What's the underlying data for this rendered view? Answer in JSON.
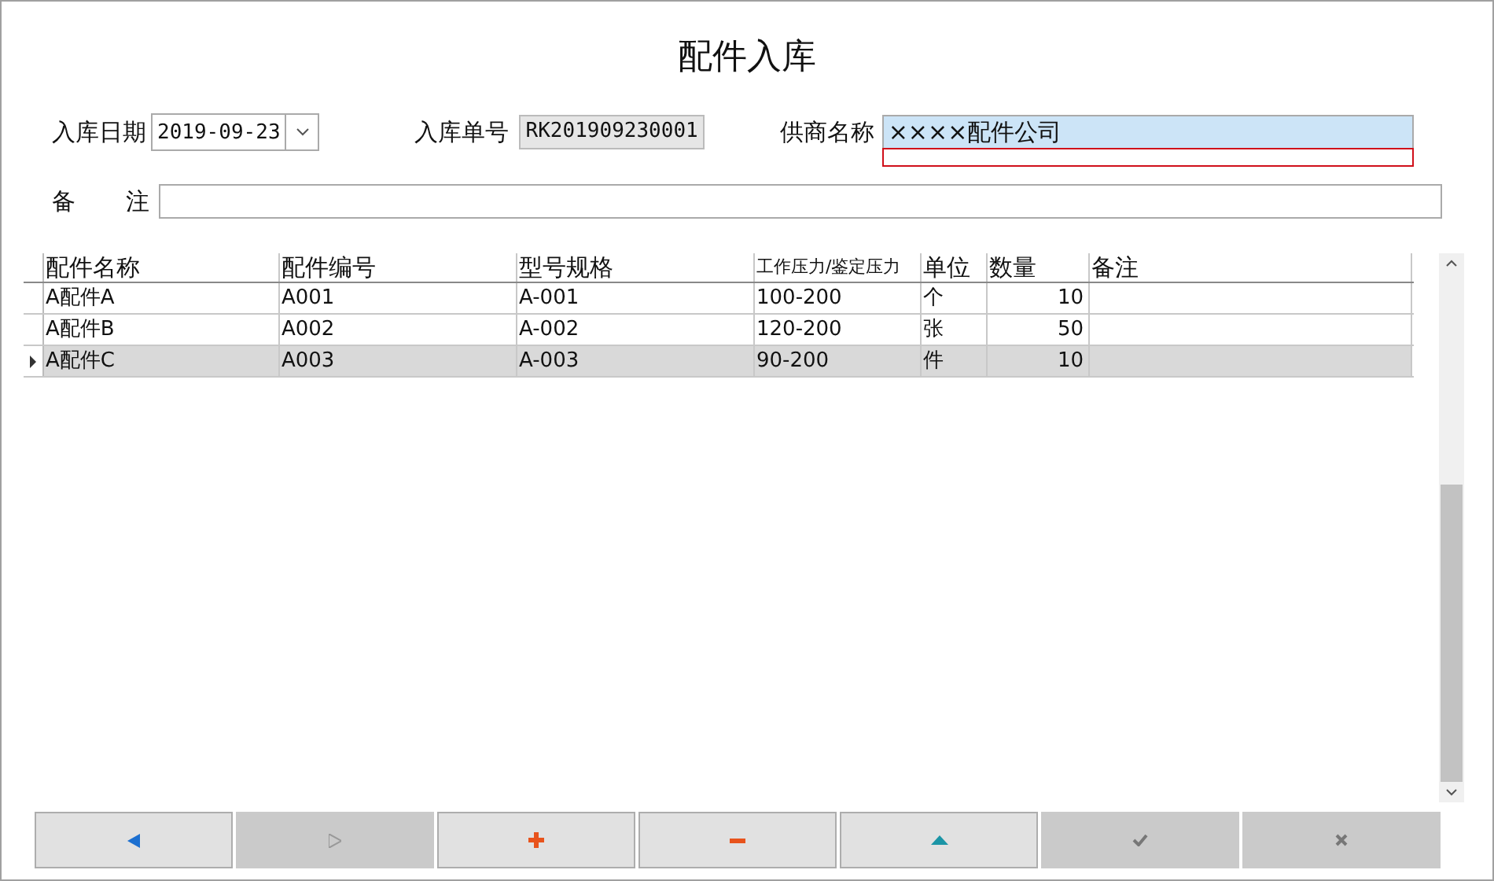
{
  "window": {
    "title": "配件入库"
  },
  "form": {
    "date_label": "入库日期",
    "date_value": "2019-09-23",
    "order_label": "入库单号",
    "order_value": "RK201909230001",
    "supplier_label": "供商名称",
    "supplier_value": "××××配件公司",
    "supplier_selected": true,
    "supplier_error": true,
    "remark_label_1": "备",
    "remark_label_2": "注"
  },
  "table": {
    "columns": [
      "配件名称",
      "配件编号",
      "型号规格",
      "工作压力/鉴定压力",
      "单位",
      "数量",
      "备注"
    ],
    "rows": [
      {
        "cells": [
          "A配件A",
          "A001",
          "A-001",
          "100-200",
          "个",
          "10",
          ""
        ],
        "selected": false
      },
      {
        "cells": [
          "A配件B",
          "A002",
          "A-002",
          "120-200",
          "张",
          "50",
          ""
        ],
        "selected": false
      },
      {
        "cells": [
          "A配件C",
          "A003",
          "A-003",
          "90-200",
          "件",
          "10",
          ""
        ],
        "selected": true
      }
    ]
  },
  "buttons": [
    {
      "kind": "prev",
      "disabled": false
    },
    {
      "kind": "next",
      "disabled": true
    },
    {
      "kind": "add",
      "disabled": false
    },
    {
      "kind": "remove",
      "disabled": false
    },
    {
      "kind": "up",
      "disabled": false
    },
    {
      "kind": "confirm",
      "disabled": true
    },
    {
      "kind": "cancel",
      "disabled": true
    }
  ]
}
